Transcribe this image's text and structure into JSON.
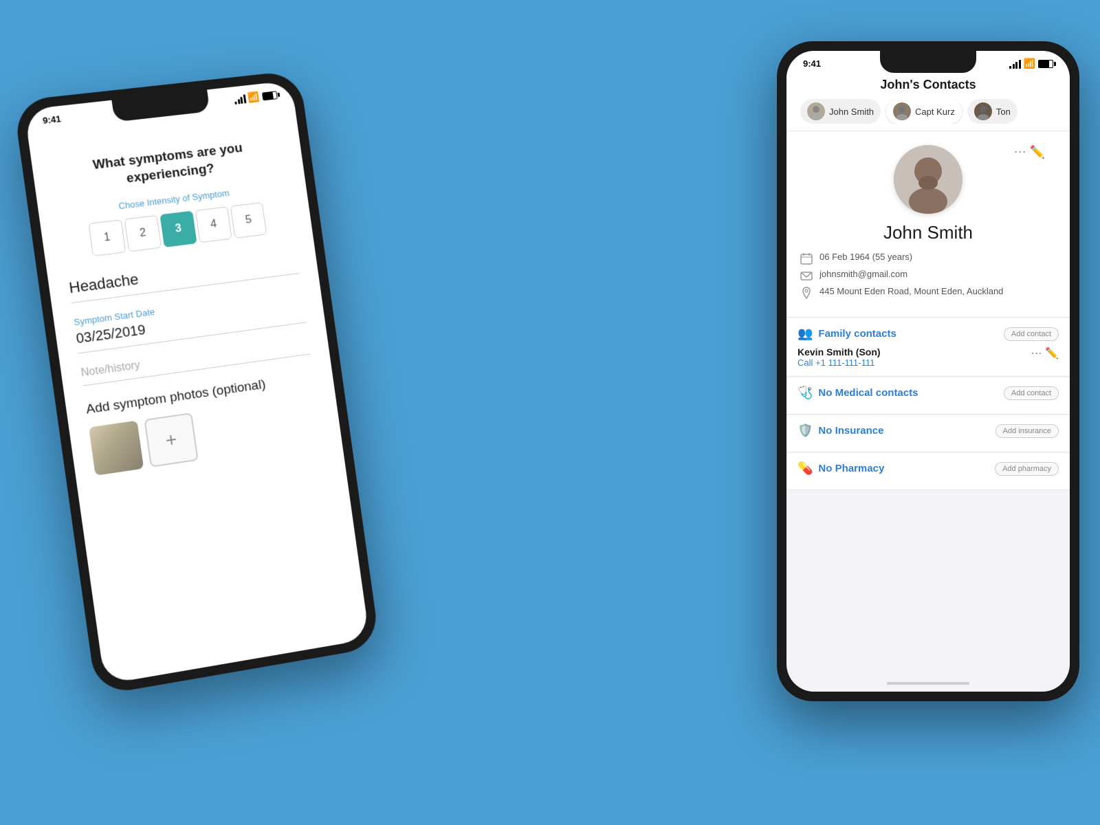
{
  "background": "#4a9fd4",
  "phone_left": {
    "time": "9:41",
    "screen": {
      "question": "What symptoms are you experiencing?",
      "intensity_label": "Chose Intensity of Symptom",
      "intensity_options": [
        "1",
        "2",
        "3",
        "4",
        "5"
      ],
      "intensity_active": 3,
      "symptom_name": "Headache",
      "start_date_label": "Symptom Start Date",
      "start_date": "03/25/2019",
      "note_placeholder": "Note/history",
      "photos_label": "Add symptom photos (optional)",
      "add_photo_icon": "+"
    }
  },
  "phone_right": {
    "time": "9:41",
    "screen": {
      "title": "John's Contacts",
      "tabs": [
        {
          "label": "John Smith",
          "active": false
        },
        {
          "label": "Capt Kurz",
          "active": true
        },
        {
          "label": "Ton",
          "active": false
        }
      ],
      "profile": {
        "name": "John Smith",
        "dob": "06 Feb 1964 (55 years)",
        "email": "johnsmith@gmail.com",
        "address": "445 Mount Eden Road, Mount Eden, Auckland"
      },
      "sections": [
        {
          "id": "family",
          "title": "Family contacts",
          "icon": "👥",
          "add_label": "Add contact",
          "entries": [
            {
              "name": "Kevin Smith (Son)",
              "phone": "Call +1 111-111-111"
            }
          ]
        },
        {
          "id": "medical",
          "title": "No Medical contacts",
          "icon": "🩺",
          "add_label": "Add contact",
          "entries": []
        },
        {
          "id": "insurance",
          "title": "No Insurance",
          "icon": "🛡️",
          "add_label": "Add insurance",
          "entries": []
        },
        {
          "id": "pharmacy",
          "title": "No Pharmacy",
          "icon": "💊",
          "add_label": "Add pharmacy",
          "entries": []
        }
      ]
    }
  }
}
